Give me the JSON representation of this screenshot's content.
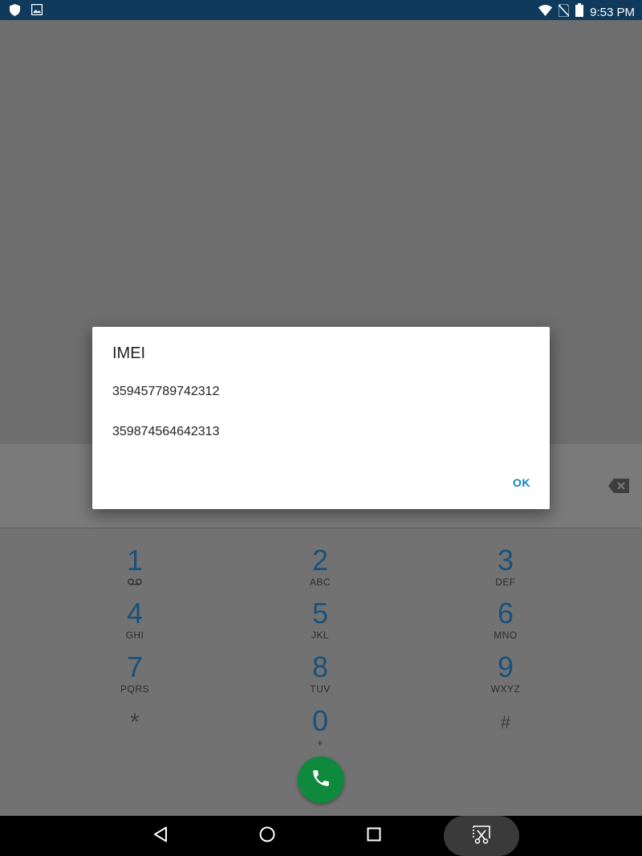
{
  "status_bar": {
    "time": "9:53 PM",
    "left_icons": [
      "shield-icon",
      "image-icon"
    ],
    "right_icons": [
      "wifi-icon",
      "no-sim-icon",
      "battery-icon"
    ]
  },
  "dialog": {
    "title": "IMEI",
    "imei_1": "359457789742312",
    "imei_2": "359874564642313",
    "ok_label": "OK"
  },
  "dialpad": {
    "keys": [
      {
        "digit": "1",
        "letters": "",
        "icon": "voicemail-icon"
      },
      {
        "digit": "2",
        "letters": "ABC"
      },
      {
        "digit": "3",
        "letters": "DEF"
      },
      {
        "digit": "4",
        "letters": "GHI"
      },
      {
        "digit": "5",
        "letters": "JKL"
      },
      {
        "digit": "6",
        "letters": "MNO"
      },
      {
        "digit": "7",
        "letters": "PQRS"
      },
      {
        "digit": "8",
        "letters": "TUV"
      },
      {
        "digit": "9",
        "letters": "WXYZ"
      },
      {
        "digit": "*",
        "letters": ""
      },
      {
        "digit": "0",
        "letters": "+"
      },
      {
        "digit": "#",
        "letters": ""
      }
    ],
    "call_icon": "phone-icon",
    "backspace_icon": "backspace-icon"
  },
  "nav_bar": {
    "icons": [
      "back-icon",
      "home-icon",
      "recents-icon",
      "screenshot-icon"
    ]
  },
  "colors": {
    "status_bar": "#0f3a5c",
    "digit": "#18517b",
    "call_button": "#0f8a3c",
    "ok_button": "#0f86b8"
  }
}
